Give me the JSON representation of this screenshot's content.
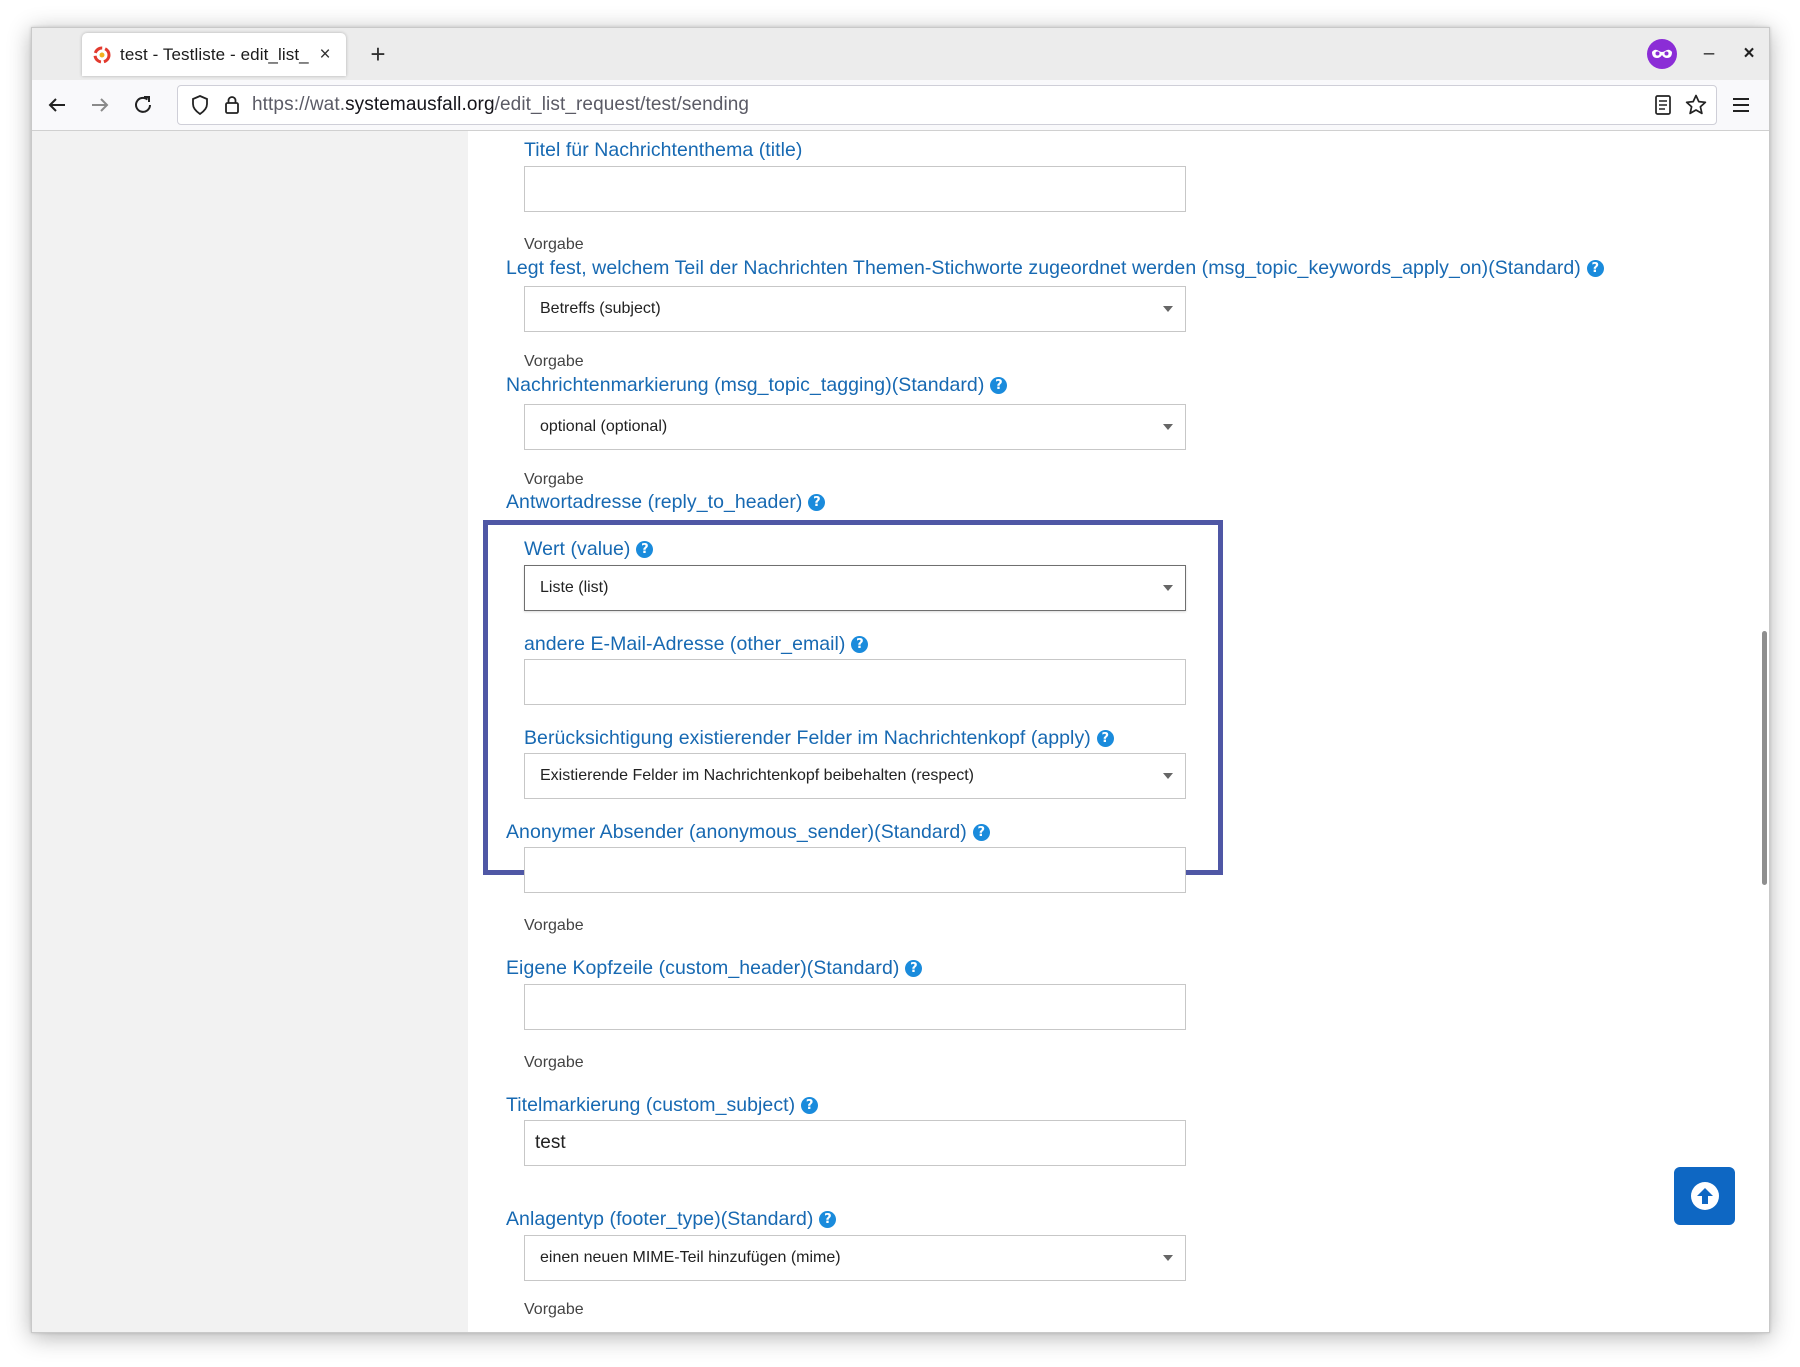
{
  "browser": {
    "tab_title": "test - Testliste - edit_list_",
    "tab_close": "×",
    "new_tab": "+",
    "minimize": "–",
    "close": "×",
    "url_prefix": "https://wat.",
    "url_host": "systemausfall.org",
    "url_path": "/edit_list_request/test/sending"
  },
  "fields": {
    "title": {
      "label": "Titel für Nachrichtenthema (title)",
      "value": "",
      "hint": "Vorgabe"
    },
    "keywords_apply_on": {
      "label": "Legt fest, welchem Teil der Nachrichten Themen-Stichworte zugeordnet werden (msg_topic_keywords_apply_on)(Standard)",
      "value": "Betreffs (subject)",
      "hint": "Vorgabe"
    },
    "topic_tagging": {
      "label": "Nachrichtenmarkierung (msg_topic_tagging)(Standard)",
      "value": "optional (optional)",
      "hint": "Vorgabe"
    },
    "reply_to_header": {
      "label": "Antwortadresse (reply_to_header)",
      "value_label": "Wert (value)",
      "value": "Liste (list)",
      "other_email_label": "andere E-Mail-Adresse (other_email)",
      "other_email": "",
      "apply_label": "Berücksichtigung existierender Felder im Nachrichtenkopf (apply)",
      "apply": "Existierende Felder im Nachrichtenkopf beibehalten (respect)"
    },
    "anonymous_sender": {
      "label": "Anonymer Absender (anonymous_sender)(Standard)",
      "value": "",
      "hint": "Vorgabe"
    },
    "custom_header": {
      "label": "Eigene Kopfzeile (custom_header)(Standard)",
      "value": "",
      "hint": "Vorgabe"
    },
    "custom_subject": {
      "label": "Titelmarkierung (custom_subject)",
      "value": "test"
    },
    "footer_type": {
      "label": "Anlagentyp (footer_type)(Standard)",
      "value": "einen neuen MIME-Teil hinzufügen (mime)",
      "hint": "Vorgabe"
    }
  },
  "help_glyph": "?",
  "colors": {
    "label": "#1769b2",
    "help": "#1a8bdc",
    "highlight": "#4f57a5",
    "fab": "#0e67c3"
  }
}
